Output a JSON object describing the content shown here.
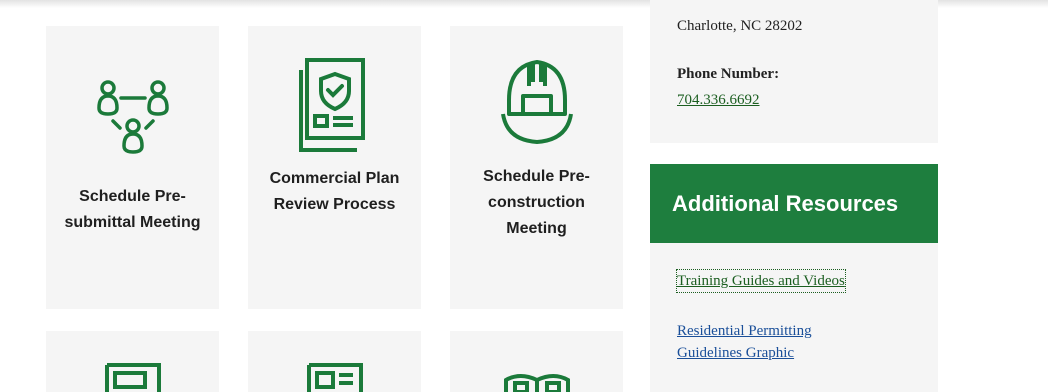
{
  "cards": [
    {
      "label": "Schedule Pre-submittal Meeting",
      "icon": "people-connection-icon"
    },
    {
      "label": "Commercial Plan Review Process",
      "icon": "shield-document-icon"
    },
    {
      "label": "Schedule Pre-construction Meeting",
      "icon": "hard-hat-icon"
    },
    {
      "label": "",
      "icon": "blueprint-icon"
    },
    {
      "label": "",
      "icon": "document-list-icon"
    },
    {
      "label": "",
      "icon": "open-book-icon"
    }
  ],
  "contact": {
    "address_line": "Charlotte, NC  28202",
    "phone_label": "Phone Number:",
    "phone_value": "704.336.6692"
  },
  "resources": {
    "header": "Additional Resources",
    "links": [
      {
        "label": "Training Guides and Videos"
      },
      {
        "label": "Residential Permitting Guidelines Graphic"
      }
    ]
  },
  "colors": {
    "brand_green": "#1e7e3e",
    "icon_green": "#1b7a3a",
    "link_blue": "#1a4f99"
  }
}
